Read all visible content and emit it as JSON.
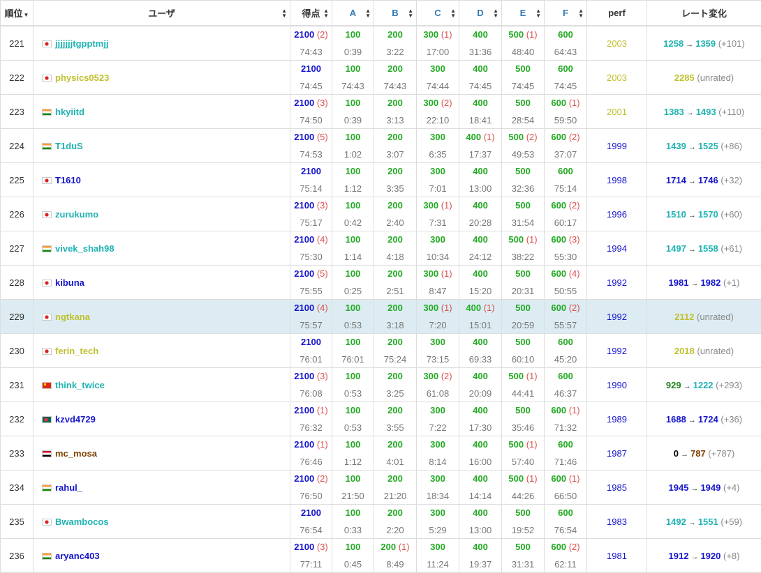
{
  "header": {
    "rank": "順位",
    "user": "ユーザ",
    "score": "得点",
    "tasks": [
      "A",
      "B",
      "C",
      "D",
      "E",
      "F"
    ],
    "perf": "perf",
    "rating": "レート変化"
  },
  "colors": {
    "cyan": "#20b2b2",
    "blue": "#1515cc",
    "yellow": "#c0c030",
    "green": "#208020",
    "brown": "#804000",
    "highlight": "#dcecf2"
  },
  "rows": [
    {
      "rank": "221",
      "flag": "jp",
      "user": "jjjjjjjtgpptmjj",
      "ucolor": "c-cyan",
      "total": "2100",
      "tpen": "(2)",
      "ttime": "74:43",
      "tasks": [
        [
          "100",
          "",
          "0:39"
        ],
        [
          "200",
          "",
          "3:22"
        ],
        [
          "300",
          "(1)",
          "17:00"
        ],
        [
          "400",
          "",
          "31:36"
        ],
        [
          "500",
          "(1)",
          "48:40"
        ],
        [
          "600",
          "",
          "64:43"
        ]
      ],
      "perf": "2003",
      "pcolor": "c-yellow",
      "before": "1258",
      "bcolor": "c-cyan",
      "after": "1359",
      "acolor": "c-cyan",
      "delta": "(+101)"
    },
    {
      "rank": "222",
      "flag": "jp",
      "user": "physics0523",
      "ucolor": "c-yellow",
      "total": "2100",
      "tpen": "",
      "ttime": "74:45",
      "tasks": [
        [
          "100",
          "",
          "74:43"
        ],
        [
          "200",
          "",
          "74:43"
        ],
        [
          "300",
          "",
          "74:44"
        ],
        [
          "400",
          "",
          "74:45"
        ],
        [
          "500",
          "",
          "74:45"
        ],
        [
          "600",
          "",
          "74:45"
        ]
      ],
      "perf": "2003",
      "pcolor": "c-yellow",
      "before": "",
      "bcolor": "",
      "after": "2285",
      "acolor": "c-yellow",
      "delta": "(unrated)"
    },
    {
      "rank": "223",
      "flag": "in",
      "user": "hkyiitd",
      "ucolor": "c-cyan",
      "total": "2100",
      "tpen": "(3)",
      "ttime": "74:50",
      "tasks": [
        [
          "100",
          "",
          "0:39"
        ],
        [
          "200",
          "",
          "3:13"
        ],
        [
          "300",
          "(2)",
          "22:10"
        ],
        [
          "400",
          "",
          "18:41"
        ],
        [
          "500",
          "",
          "28:54"
        ],
        [
          "600",
          "(1)",
          "59:50"
        ]
      ],
      "perf": "2001",
      "pcolor": "c-yellow",
      "before": "1383",
      "bcolor": "c-cyan",
      "after": "1493",
      "acolor": "c-cyan",
      "delta": "(+110)"
    },
    {
      "rank": "224",
      "flag": "in",
      "user": "T1duS",
      "ucolor": "c-cyan",
      "total": "2100",
      "tpen": "(5)",
      "ttime": "74:53",
      "tasks": [
        [
          "100",
          "",
          "1:02"
        ],
        [
          "200",
          "",
          "3:07"
        ],
        [
          "300",
          "",
          "6:35"
        ],
        [
          "400",
          "(1)",
          "17:37"
        ],
        [
          "500",
          "(2)",
          "49:53"
        ],
        [
          "600",
          "(2)",
          "37:07"
        ]
      ],
      "perf": "1999",
      "pcolor": "c-blue",
      "before": "1439",
      "bcolor": "c-cyan",
      "after": "1525",
      "acolor": "c-cyan",
      "delta": "(+86)"
    },
    {
      "rank": "225",
      "flag": "jp",
      "user": "T1610",
      "ucolor": "c-blue",
      "total": "2100",
      "tpen": "",
      "ttime": "75:14",
      "tasks": [
        [
          "100",
          "",
          "1:12"
        ],
        [
          "200",
          "",
          "3:35"
        ],
        [
          "300",
          "",
          "7:01"
        ],
        [
          "400",
          "",
          "13:00"
        ],
        [
          "500",
          "",
          "32:36"
        ],
        [
          "600",
          "",
          "75:14"
        ]
      ],
      "perf": "1998",
      "pcolor": "c-blue",
      "before": "1714",
      "bcolor": "c-blue",
      "after": "1746",
      "acolor": "c-blue",
      "delta": "(+32)"
    },
    {
      "rank": "226",
      "flag": "jp",
      "user": "zurukumo",
      "ucolor": "c-cyan",
      "total": "2100",
      "tpen": "(3)",
      "ttime": "75:17",
      "tasks": [
        [
          "100",
          "",
          "0:42"
        ],
        [
          "200",
          "",
          "2:40"
        ],
        [
          "300",
          "(1)",
          "7:31"
        ],
        [
          "400",
          "",
          "20:28"
        ],
        [
          "500",
          "",
          "31:54"
        ],
        [
          "600",
          "(2)",
          "60:17"
        ]
      ],
      "perf": "1996",
      "pcolor": "c-blue",
      "before": "1510",
      "bcolor": "c-cyan",
      "after": "1570",
      "acolor": "c-cyan",
      "delta": "(+60)"
    },
    {
      "rank": "227",
      "flag": "in",
      "user": "vivek_shah98",
      "ucolor": "c-cyan",
      "total": "2100",
      "tpen": "(4)",
      "ttime": "75:30",
      "tasks": [
        [
          "100",
          "",
          "1:14"
        ],
        [
          "200",
          "",
          "4:18"
        ],
        [
          "300",
          "",
          "10:34"
        ],
        [
          "400",
          "",
          "24:12"
        ],
        [
          "500",
          "(1)",
          "38:22"
        ],
        [
          "600",
          "(3)",
          "55:30"
        ]
      ],
      "perf": "1994",
      "pcolor": "c-blue",
      "before": "1497",
      "bcolor": "c-cyan",
      "after": "1558",
      "acolor": "c-cyan",
      "delta": "(+61)"
    },
    {
      "rank": "228",
      "flag": "jp",
      "user": "kibuna",
      "ucolor": "c-blue",
      "total": "2100",
      "tpen": "(5)",
      "ttime": "75:55",
      "tasks": [
        [
          "100",
          "",
          "0:25"
        ],
        [
          "200",
          "",
          "2:51"
        ],
        [
          "300",
          "(1)",
          "8:47"
        ],
        [
          "400",
          "",
          "15:20"
        ],
        [
          "500",
          "",
          "20:31"
        ],
        [
          "600",
          "(4)",
          "50:55"
        ]
      ],
      "perf": "1992",
      "pcolor": "c-blue",
      "before": "1981",
      "bcolor": "c-blue",
      "after": "1982",
      "acolor": "c-blue",
      "delta": "(+1)"
    },
    {
      "rank": "229",
      "flag": "jp",
      "user": "ngtkana",
      "ucolor": "c-yellow",
      "total": "2100",
      "tpen": "(4)",
      "ttime": "75:57",
      "hl": true,
      "tasks": [
        [
          "100",
          "",
          "0:53"
        ],
        [
          "200",
          "",
          "3:18"
        ],
        [
          "300",
          "(1)",
          "7:20"
        ],
        [
          "400",
          "(1)",
          "15:01"
        ],
        [
          "500",
          "",
          "20:59"
        ],
        [
          "600",
          "(2)",
          "55:57"
        ]
      ],
      "perf": "1992",
      "pcolor": "c-blue",
      "before": "",
      "bcolor": "",
      "after": "2112",
      "acolor": "c-yellow",
      "delta": "(unrated)"
    },
    {
      "rank": "230",
      "flag": "jp",
      "user": "ferin_tech",
      "ucolor": "c-yellow",
      "total": "2100",
      "tpen": "",
      "ttime": "76:01",
      "tasks": [
        [
          "100",
          "",
          "76:01"
        ],
        [
          "200",
          "",
          "75:24"
        ],
        [
          "300",
          "",
          "73:15"
        ],
        [
          "400",
          "",
          "69:33"
        ],
        [
          "500",
          "",
          "60:10"
        ],
        [
          "600",
          "",
          "45:20"
        ]
      ],
      "perf": "1992",
      "pcolor": "c-blue",
      "before": "",
      "bcolor": "",
      "after": "2018",
      "acolor": "c-yellow",
      "delta": "(unrated)"
    },
    {
      "rank": "231",
      "flag": "cn",
      "user": "think_twice",
      "ucolor": "c-cyan",
      "total": "2100",
      "tpen": "(3)",
      "ttime": "76:08",
      "tasks": [
        [
          "100",
          "",
          "0:53"
        ],
        [
          "200",
          "",
          "3:25"
        ],
        [
          "300",
          "(2)",
          "61:08"
        ],
        [
          "400",
          "",
          "20:09"
        ],
        [
          "500",
          "(1)",
          "44:41"
        ],
        [
          "600",
          "",
          "46:37"
        ]
      ],
      "perf": "1990",
      "pcolor": "c-blue",
      "before": "929",
      "bcolor": "c-green",
      "after": "1222",
      "acolor": "c-cyan",
      "delta": "(+293)"
    },
    {
      "rank": "232",
      "flag": "bd",
      "user": "kzvd4729",
      "ucolor": "c-blue",
      "total": "2100",
      "tpen": "(1)",
      "ttime": "76:32",
      "tasks": [
        [
          "100",
          "",
          "0:53"
        ],
        [
          "200",
          "",
          "3:55"
        ],
        [
          "300",
          "",
          "7:22"
        ],
        [
          "400",
          "",
          "17:30"
        ],
        [
          "500",
          "",
          "35:46"
        ],
        [
          "600",
          "(1)",
          "71:32"
        ]
      ],
      "perf": "1989",
      "pcolor": "c-blue",
      "before": "1688",
      "bcolor": "c-blue",
      "after": "1724",
      "acolor": "c-blue",
      "delta": "(+36)"
    },
    {
      "rank": "233",
      "flag": "eg",
      "user": "mc_mosa",
      "ucolor": "c-brown",
      "total": "2100",
      "tpen": "(1)",
      "ttime": "76:46",
      "tasks": [
        [
          "100",
          "",
          "1:12"
        ],
        [
          "200",
          "",
          "4:01"
        ],
        [
          "300",
          "",
          "8:14"
        ],
        [
          "400",
          "",
          "16:00"
        ],
        [
          "500",
          "(1)",
          "57:40"
        ],
        [
          "600",
          "",
          "71:46"
        ]
      ],
      "perf": "1987",
      "pcolor": "c-blue",
      "before": "0",
      "bcolor": "c-black",
      "after": "787",
      "acolor": "c-brown",
      "delta": "(+787)"
    },
    {
      "rank": "234",
      "flag": "in",
      "user": "rahul_",
      "ucolor": "c-blue",
      "total": "2100",
      "tpen": "(2)",
      "ttime": "76:50",
      "tasks": [
        [
          "100",
          "",
          "21:50"
        ],
        [
          "200",
          "",
          "21:20"
        ],
        [
          "300",
          "",
          "18:34"
        ],
        [
          "400",
          "",
          "14:14"
        ],
        [
          "500",
          "(1)",
          "44:26"
        ],
        [
          "600",
          "(1)",
          "66:50"
        ]
      ],
      "perf": "1985",
      "pcolor": "c-blue",
      "before": "1945",
      "bcolor": "c-blue",
      "after": "1949",
      "acolor": "c-blue",
      "delta": "(+4)"
    },
    {
      "rank": "235",
      "flag": "jp",
      "user": "Bwambocos",
      "ucolor": "c-cyan",
      "total": "2100",
      "tpen": "",
      "ttime": "76:54",
      "tasks": [
        [
          "100",
          "",
          "0:33"
        ],
        [
          "200",
          "",
          "2:20"
        ],
        [
          "300",
          "",
          "5:29"
        ],
        [
          "400",
          "",
          "13:00"
        ],
        [
          "500",
          "",
          "19:52"
        ],
        [
          "600",
          "",
          "76:54"
        ]
      ],
      "perf": "1983",
      "pcolor": "c-blue",
      "before": "1492",
      "bcolor": "c-cyan",
      "after": "1551",
      "acolor": "c-cyan",
      "delta": "(+59)"
    },
    {
      "rank": "236",
      "flag": "in",
      "user": "aryanc403",
      "ucolor": "c-blue",
      "total": "2100",
      "tpen": "(3)",
      "ttime": "77:11",
      "tasks": [
        [
          "100",
          "",
          "0:45"
        ],
        [
          "200",
          "(1)",
          "8:49"
        ],
        [
          "300",
          "",
          "11:24"
        ],
        [
          "400",
          "",
          "19:37"
        ],
        [
          "500",
          "",
          "31:31"
        ],
        [
          "600",
          "(2)",
          "62:11"
        ]
      ],
      "perf": "1981",
      "pcolor": "c-blue",
      "before": "1912",
      "bcolor": "c-blue",
      "after": "1920",
      "acolor": "c-blue",
      "delta": "(+8)"
    }
  ]
}
